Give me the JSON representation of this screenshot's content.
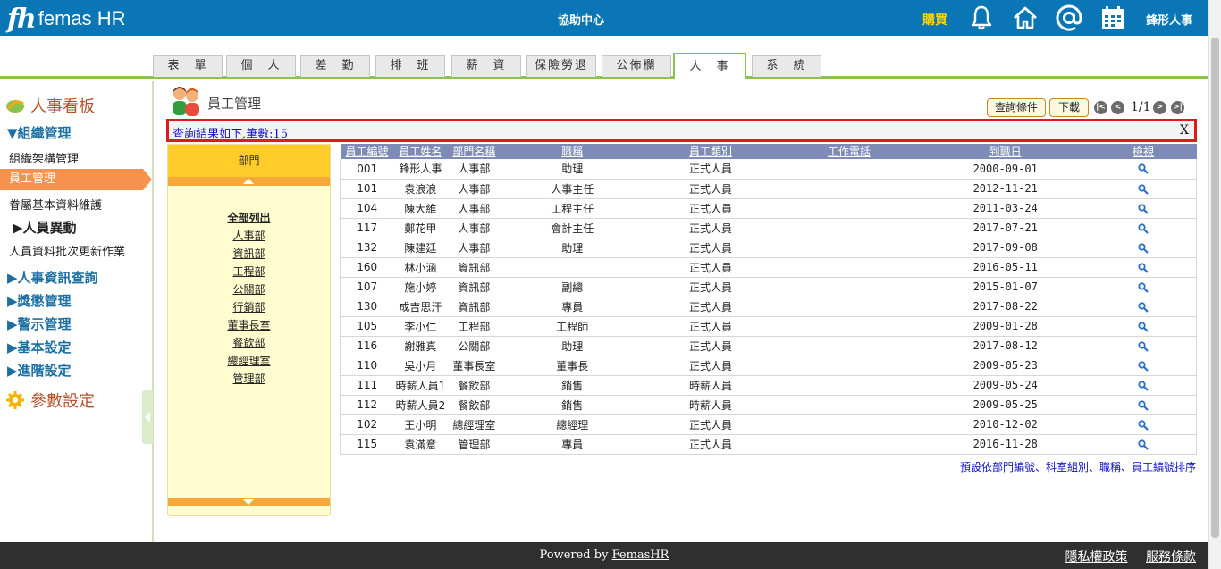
{
  "header": {
    "logo_mark": "fh",
    "logo_text": "femas HR",
    "center_title": "協助中心",
    "buy_label": "購買",
    "icons": [
      "bell-icon",
      "home-icon",
      "at-icon",
      "calendar-icon"
    ],
    "user_name": "鋒形人事",
    "bg_color": "#0a76b6"
  },
  "tabs": [
    {
      "label": "表　單",
      "active": false
    },
    {
      "label": "個　人",
      "active": false
    },
    {
      "label": "差　勤",
      "active": false
    },
    {
      "label": "排　班",
      "active": false
    },
    {
      "label": "薪　資",
      "active": false
    },
    {
      "label": "保險勞退",
      "active": false
    },
    {
      "label": "公佈欄",
      "active": false
    },
    {
      "label": "人　事",
      "active": true
    },
    {
      "label": "系　統",
      "active": false
    }
  ],
  "sidebar": {
    "board_title": "人事看板",
    "org_group": "▼組織管理",
    "org_items": [
      "組織架構管理",
      "員工管理",
      "眷屬基本資料維護"
    ],
    "active_item": "員工管理",
    "change_group": "▶人員異動",
    "batch_item": "人員資料批次更新作業",
    "groups": [
      "▶人事資訊查詢",
      "▶獎懲管理",
      "▶警示管理",
      "▶基本設定",
      "▶進階設定"
    ],
    "param_title": "參數設定"
  },
  "content": {
    "page_title": "員工管理",
    "query_button": "查詢條件",
    "download_button": "下載",
    "pager": {
      "first": "|<",
      "prev": "<",
      "text": "1/1",
      "next": ">",
      "last": ">|"
    },
    "result_text": "查詢結果如下,筆數:15",
    "close_label": "X",
    "sort_note": "預設依部門編號、科室組別、職稱、員工編號排序"
  },
  "dept_panel": {
    "title": "部門",
    "items": [
      "全部列出",
      "人事部",
      "資訊部",
      "工程部",
      "公關部",
      "行銷部",
      "董事長室",
      "餐飲部",
      "總經理室",
      "管理部"
    ]
  },
  "table": {
    "columns": [
      "員工編號",
      "員工姓名",
      "部門名稱",
      "職稱",
      "員工類別",
      "工作電話",
      "到職日",
      "檢視"
    ],
    "rows": [
      [
        "001",
        "鋒形人事",
        "人事部",
        "助理",
        "正式人員",
        "",
        "2000-09-01"
      ],
      [
        "101",
        "袁浪浪",
        "人事部",
        "人事主任",
        "正式人員",
        "",
        "2012-11-21"
      ],
      [
        "104",
        "陳大維",
        "人事部",
        "工程主任",
        "正式人員",
        "",
        "2011-03-24"
      ],
      [
        "117",
        "鄭花甲",
        "人事部",
        "會計主任",
        "正式人員",
        "",
        "2017-07-21"
      ],
      [
        "132",
        "陳建廷",
        "人事部",
        "助理",
        "正式人員",
        "",
        "2017-09-08"
      ],
      [
        "160",
        "林小涵",
        "資訊部",
        "",
        "正式人員",
        "",
        "2016-05-11"
      ],
      [
        "107",
        "施小婷",
        "資訊部",
        "副總",
        "正式人員",
        "",
        "2015-01-07"
      ],
      [
        "130",
        "成吉思汗",
        "資訊部",
        "專員",
        "正式人員",
        "",
        "2017-08-22"
      ],
      [
        "105",
        "李小仁",
        "工程部",
        "工程師",
        "正式人員",
        "",
        "2009-01-28"
      ],
      [
        "116",
        "謝雅真",
        "公關部",
        "助理",
        "正式人員",
        "",
        "2017-08-12"
      ],
      [
        "110",
        "吳小月",
        "董事長室",
        "董事長",
        "正式人員",
        "",
        "2009-05-23"
      ],
      [
        "111",
        "時薪人員1",
        "餐飲部",
        "銷售",
        "時薪人員",
        "",
        "2009-05-24"
      ],
      [
        "112",
        "時薪人員2",
        "餐飲部",
        "銷售",
        "時薪人員",
        "",
        "2009-05-25"
      ],
      [
        "102",
        "王小明",
        "總經理室",
        "總經理",
        "正式人員",
        "",
        "2010-12-02"
      ],
      [
        "115",
        "袁滿意",
        "管理部",
        "專員",
        "正式人員",
        "",
        "2016-11-28"
      ]
    ]
  },
  "footer": {
    "powered_prefix": "Powered by ",
    "powered_link": "FemasHR",
    "privacy": "隱私權政策",
    "terms": "服務條款"
  }
}
